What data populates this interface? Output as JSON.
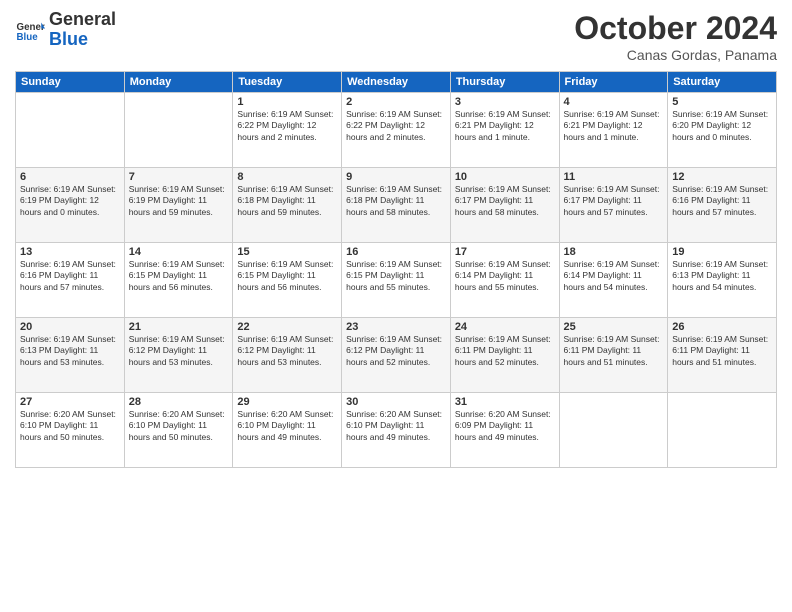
{
  "header": {
    "logo_general": "General",
    "logo_blue": "Blue",
    "month_title": "October 2024",
    "location": "Canas Gordas, Panama"
  },
  "weekdays": [
    "Sunday",
    "Monday",
    "Tuesday",
    "Wednesday",
    "Thursday",
    "Friday",
    "Saturday"
  ],
  "weeks": [
    [
      {
        "day": "",
        "info": ""
      },
      {
        "day": "",
        "info": ""
      },
      {
        "day": "1",
        "info": "Sunrise: 6:19 AM\nSunset: 6:22 PM\nDaylight: 12 hours and 2 minutes."
      },
      {
        "day": "2",
        "info": "Sunrise: 6:19 AM\nSunset: 6:22 PM\nDaylight: 12 hours and 2 minutes."
      },
      {
        "day": "3",
        "info": "Sunrise: 6:19 AM\nSunset: 6:21 PM\nDaylight: 12 hours and 1 minute."
      },
      {
        "day": "4",
        "info": "Sunrise: 6:19 AM\nSunset: 6:21 PM\nDaylight: 12 hours and 1 minute."
      },
      {
        "day": "5",
        "info": "Sunrise: 6:19 AM\nSunset: 6:20 PM\nDaylight: 12 hours and 0 minutes."
      }
    ],
    [
      {
        "day": "6",
        "info": "Sunrise: 6:19 AM\nSunset: 6:19 PM\nDaylight: 12 hours and 0 minutes."
      },
      {
        "day": "7",
        "info": "Sunrise: 6:19 AM\nSunset: 6:19 PM\nDaylight: 11 hours and 59 minutes."
      },
      {
        "day": "8",
        "info": "Sunrise: 6:19 AM\nSunset: 6:18 PM\nDaylight: 11 hours and 59 minutes."
      },
      {
        "day": "9",
        "info": "Sunrise: 6:19 AM\nSunset: 6:18 PM\nDaylight: 11 hours and 58 minutes."
      },
      {
        "day": "10",
        "info": "Sunrise: 6:19 AM\nSunset: 6:17 PM\nDaylight: 11 hours and 58 minutes."
      },
      {
        "day": "11",
        "info": "Sunrise: 6:19 AM\nSunset: 6:17 PM\nDaylight: 11 hours and 57 minutes."
      },
      {
        "day": "12",
        "info": "Sunrise: 6:19 AM\nSunset: 6:16 PM\nDaylight: 11 hours and 57 minutes."
      }
    ],
    [
      {
        "day": "13",
        "info": "Sunrise: 6:19 AM\nSunset: 6:16 PM\nDaylight: 11 hours and 57 minutes."
      },
      {
        "day": "14",
        "info": "Sunrise: 6:19 AM\nSunset: 6:15 PM\nDaylight: 11 hours and 56 minutes."
      },
      {
        "day": "15",
        "info": "Sunrise: 6:19 AM\nSunset: 6:15 PM\nDaylight: 11 hours and 56 minutes."
      },
      {
        "day": "16",
        "info": "Sunrise: 6:19 AM\nSunset: 6:15 PM\nDaylight: 11 hours and 55 minutes."
      },
      {
        "day": "17",
        "info": "Sunrise: 6:19 AM\nSunset: 6:14 PM\nDaylight: 11 hours and 55 minutes."
      },
      {
        "day": "18",
        "info": "Sunrise: 6:19 AM\nSunset: 6:14 PM\nDaylight: 11 hours and 54 minutes."
      },
      {
        "day": "19",
        "info": "Sunrise: 6:19 AM\nSunset: 6:13 PM\nDaylight: 11 hours and 54 minutes."
      }
    ],
    [
      {
        "day": "20",
        "info": "Sunrise: 6:19 AM\nSunset: 6:13 PM\nDaylight: 11 hours and 53 minutes."
      },
      {
        "day": "21",
        "info": "Sunrise: 6:19 AM\nSunset: 6:12 PM\nDaylight: 11 hours and 53 minutes."
      },
      {
        "day": "22",
        "info": "Sunrise: 6:19 AM\nSunset: 6:12 PM\nDaylight: 11 hours and 53 minutes."
      },
      {
        "day": "23",
        "info": "Sunrise: 6:19 AM\nSunset: 6:12 PM\nDaylight: 11 hours and 52 minutes."
      },
      {
        "day": "24",
        "info": "Sunrise: 6:19 AM\nSunset: 6:11 PM\nDaylight: 11 hours and 52 minutes."
      },
      {
        "day": "25",
        "info": "Sunrise: 6:19 AM\nSunset: 6:11 PM\nDaylight: 11 hours and 51 minutes."
      },
      {
        "day": "26",
        "info": "Sunrise: 6:19 AM\nSunset: 6:11 PM\nDaylight: 11 hours and 51 minutes."
      }
    ],
    [
      {
        "day": "27",
        "info": "Sunrise: 6:20 AM\nSunset: 6:10 PM\nDaylight: 11 hours and 50 minutes."
      },
      {
        "day": "28",
        "info": "Sunrise: 6:20 AM\nSunset: 6:10 PM\nDaylight: 11 hours and 50 minutes."
      },
      {
        "day": "29",
        "info": "Sunrise: 6:20 AM\nSunset: 6:10 PM\nDaylight: 11 hours and 49 minutes."
      },
      {
        "day": "30",
        "info": "Sunrise: 6:20 AM\nSunset: 6:10 PM\nDaylight: 11 hours and 49 minutes."
      },
      {
        "day": "31",
        "info": "Sunrise: 6:20 AM\nSunset: 6:09 PM\nDaylight: 11 hours and 49 minutes."
      },
      {
        "day": "",
        "info": ""
      },
      {
        "day": "",
        "info": ""
      }
    ]
  ]
}
